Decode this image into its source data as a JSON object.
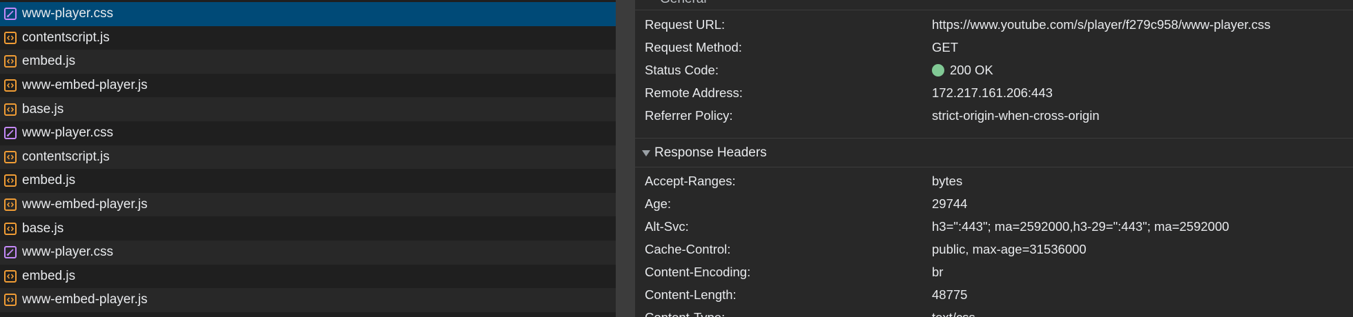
{
  "requests": [
    {
      "name": "www-player.css",
      "type": "css",
      "selected": true
    },
    {
      "name": "contentscript.js",
      "type": "js",
      "selected": false
    },
    {
      "name": "embed.js",
      "type": "js",
      "selected": false
    },
    {
      "name": "www-embed-player.js",
      "type": "js",
      "selected": false
    },
    {
      "name": "base.js",
      "type": "js",
      "selected": false
    },
    {
      "name": "www-player.css",
      "type": "css",
      "selected": false
    },
    {
      "name": "contentscript.js",
      "type": "js",
      "selected": false
    },
    {
      "name": "embed.js",
      "type": "js",
      "selected": false
    },
    {
      "name": "www-embed-player.js",
      "type": "js",
      "selected": false
    },
    {
      "name": "base.js",
      "type": "js",
      "selected": false
    },
    {
      "name": "www-player.css",
      "type": "css",
      "selected": false
    },
    {
      "name": "embed.js",
      "type": "js",
      "selected": false
    },
    {
      "name": "www-embed-player.js",
      "type": "js",
      "selected": false
    }
  ],
  "general": {
    "title": "General",
    "rows": [
      {
        "key": "Request URL:",
        "value": "https://www.youtube.com/s/player/f279c958/www-player.css"
      },
      {
        "key": "Request Method:",
        "value": "GET"
      },
      {
        "key": "Status Code:",
        "value": "200 OK"
      },
      {
        "key": "Remote Address:",
        "value": "172.217.161.206:443"
      },
      {
        "key": "Referrer Policy:",
        "value": "strict-origin-when-cross-origin"
      }
    ]
  },
  "response_headers": {
    "title": "Response Headers",
    "rows": [
      {
        "key": "Accept-Ranges:",
        "value": "bytes"
      },
      {
        "key": "Age:",
        "value": "29744"
      },
      {
        "key": "Alt-Svc:",
        "value": "h3=\":443\"; ma=2592000,h3-29=\":443\"; ma=2592000"
      },
      {
        "key": "Cache-Control:",
        "value": "public, max-age=31536000"
      },
      {
        "key": "Content-Encoding:",
        "value": "br"
      },
      {
        "key": "Content-Length:",
        "value": "48775"
      },
      {
        "key": "Content-Type:",
        "value": "text/css"
      }
    ]
  },
  "colors": {
    "selected_row": "#004a77",
    "js_icon": "#f19d35",
    "css_icon": "#c58af9",
    "status_ok": "#81c995"
  }
}
